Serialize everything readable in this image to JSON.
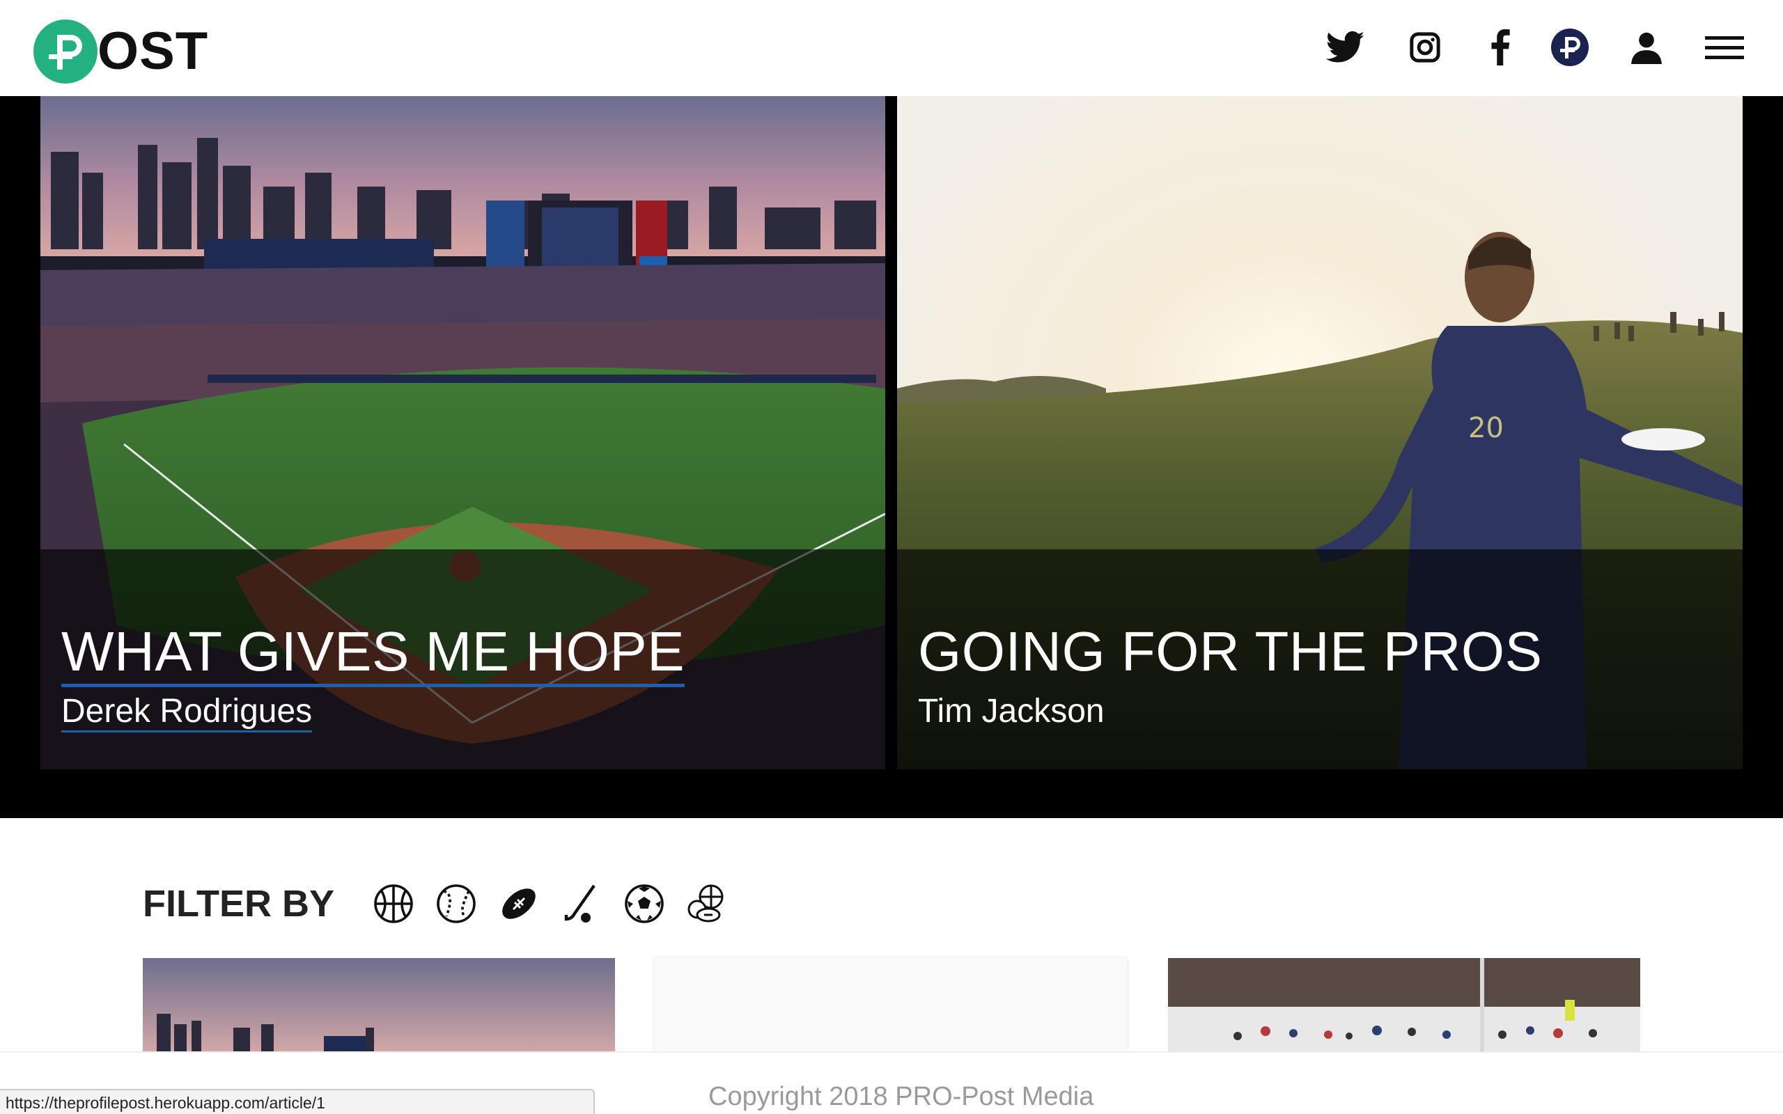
{
  "header": {
    "logo_text": "OST",
    "icons": [
      "twitter-icon",
      "instagram-icon",
      "facebook-icon",
      "post-logo-icon",
      "user-icon",
      "menu-icon"
    ]
  },
  "hero": {
    "articles": [
      {
        "title": "WHAT GIVES ME HOPE",
        "author": "Derek Rodrigues"
      },
      {
        "title": "GOING FOR THE PROS",
        "author": "Tim Jackson"
      }
    ]
  },
  "filter": {
    "label": "FILTER BY",
    "sports": [
      "basketball-icon",
      "baseball-icon",
      "football-icon",
      "hockey-icon",
      "soccer-icon",
      "all-sports-icon"
    ]
  },
  "footer": {
    "copyright": "Copyright 2018 PRO-Post Media"
  },
  "status_bar": {
    "url": "https://theprofilepost.herokuapp.com/article/1"
  },
  "colors": {
    "brand_green": "#23b17f",
    "link_underline": "#1f5ea8",
    "navy_badge": "#1b2350"
  }
}
